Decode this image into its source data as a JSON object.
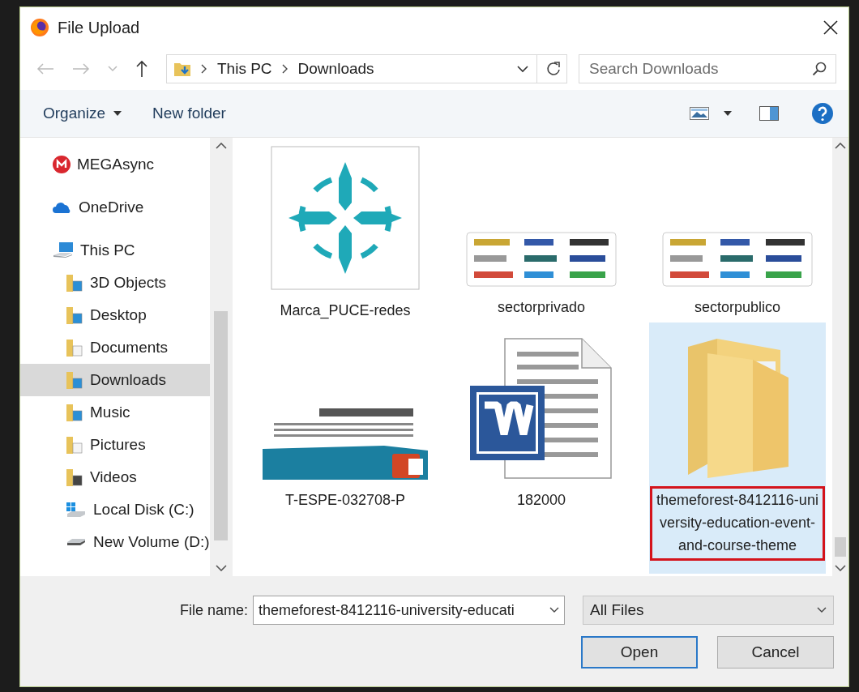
{
  "window": {
    "title": "File Upload"
  },
  "address": {
    "segments": [
      "This PC",
      "Downloads"
    ]
  },
  "search": {
    "placeholder": "Search Downloads"
  },
  "toolbar": {
    "organize": "Organize",
    "new_folder": "New folder"
  },
  "sidebar": {
    "items": [
      {
        "label": "MEGAsync",
        "kind": "mega",
        "selected": false
      },
      {
        "label": "OneDrive",
        "kind": "cloud",
        "selected": false
      },
      {
        "label": "This PC",
        "kind": "pc",
        "selected": false,
        "children": [
          {
            "label": "3D Objects",
            "kind": "folder",
            "selected": false
          },
          {
            "label": "Desktop",
            "kind": "folder",
            "selected": false
          },
          {
            "label": "Documents",
            "kind": "docfolder",
            "selected": false
          },
          {
            "label": "Downloads",
            "kind": "folder",
            "selected": true
          },
          {
            "label": "Music",
            "kind": "folder",
            "selected": false
          },
          {
            "label": "Pictures",
            "kind": "docfolder",
            "selected": false
          },
          {
            "label": "Videos",
            "kind": "videofolder",
            "selected": false
          },
          {
            "label": "Local Disk (C:)",
            "kind": "windisk",
            "selected": false
          },
          {
            "label": "New Volume (D:)",
            "kind": "disk",
            "selected": false
          }
        ]
      }
    ]
  },
  "files": [
    {
      "name": "Marca_PUCE-redes",
      "kind": "logo",
      "selected": false,
      "annotated": false
    },
    {
      "name": "sectorprivado",
      "kind": "collage",
      "selected": false,
      "annotated": false
    },
    {
      "name": "sectorpublico",
      "kind": "collage",
      "selected": false,
      "annotated": false
    },
    {
      "name": "T-ESPE-032708-P",
      "kind": "presentation",
      "selected": false,
      "annotated": false
    },
    {
      "name": "182000",
      "kind": "word",
      "selected": false,
      "annotated": false
    },
    {
      "name": "themeforest-8412116-university-education-event-and-course-theme",
      "kind": "folder",
      "selected": true,
      "annotated": true
    }
  ],
  "footer": {
    "file_name_label": "File name:",
    "file_name_value": "themeforest-8412116-university-educati",
    "file_type": "All Files",
    "buttons": [
      {
        "label": "Open",
        "default": true
      },
      {
        "label": "Cancel",
        "default": false
      }
    ]
  }
}
